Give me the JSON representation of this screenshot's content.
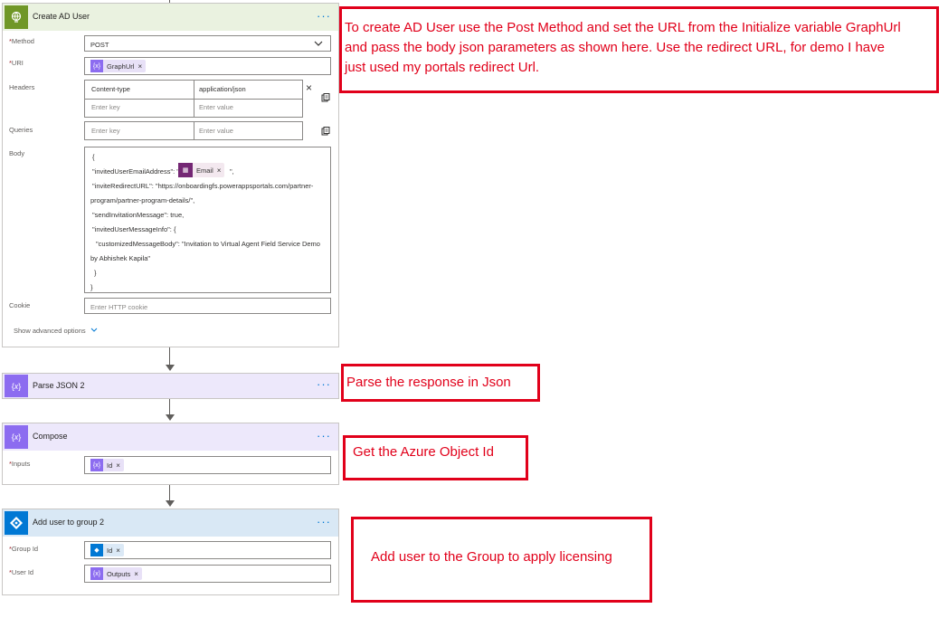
{
  "create_ad_user": {
    "title": "Create AD User",
    "menu": "···",
    "method_label": "Method",
    "method_value": "POST",
    "uri_label": "URI",
    "uri_chip": "GraphUrl",
    "headers_label": "Headers",
    "header_key": "Content-type",
    "header_value": "application/json",
    "key_placeholder": "Enter key",
    "value_placeholder": "Enter value",
    "queries_label": "Queries",
    "body_label": "Body",
    "body_lines": {
      "l1": "{",
      "l2_pre": "\"invitedUserEmailAddress\": \"",
      "l2_chip": "Email",
      "l2_post": "\",",
      "l3": "\"inviteRedirectURL\": \"https://onboardingfs.powerappsportals.com/partner-",
      "l4": "program/partner-program-details/\",",
      "l5": "\"sendInvitationMessage\": true,",
      "l6": "\"invitedUserMessageInfo\": {",
      "l7": "\"customizedMessageBody\": \"Invitation to Virtual Agent Field Service Demo",
      "l8": "by Abhishek Kapila\"",
      "l9": "}",
      "l10": "}"
    },
    "cookie_label": "Cookie",
    "cookie_placeholder": "Enter HTTP cookie",
    "advanced": "Show advanced options"
  },
  "parse_json": {
    "title": "Parse JSON 2",
    "menu": "···"
  },
  "compose": {
    "title": "Compose",
    "menu": "···",
    "inputs_label": "Inputs",
    "inputs_chip": "Id"
  },
  "add_user": {
    "title": "Add user to group 2",
    "menu": "···",
    "group_label": "Group Id",
    "group_chip": "Id",
    "user_label": "User Id",
    "user_chip": "Outputs"
  },
  "annotations": {
    "a1": "To create AD User use the Post Method and set the URL from the Initialize variable GraphUrl and pass the body json parameters as shown here. Use the redirect URL, for demo I have just used my portals redirect Url.",
    "a2": "Parse the response in Json",
    "a3": "Get the Azure Object Id",
    "a4": "Add user to the Group to apply licensing"
  },
  "colors": {
    "http_header": "#eaf2e0",
    "http_icon": "#709727",
    "var_header": "#ede8fb",
    "var_icon": "#8c6cf0",
    "aad_header": "#d9e8f5",
    "aad_icon": "#0078d4",
    "annotation": "#e1001a"
  },
  "icons": {
    "http": "globe-icon",
    "variable": "curly-braces-icon",
    "aad": "azure-ad-icon",
    "chevron": "chevron-down-icon",
    "close": "close-icon",
    "switch_mode": "switch-mode-icon"
  }
}
